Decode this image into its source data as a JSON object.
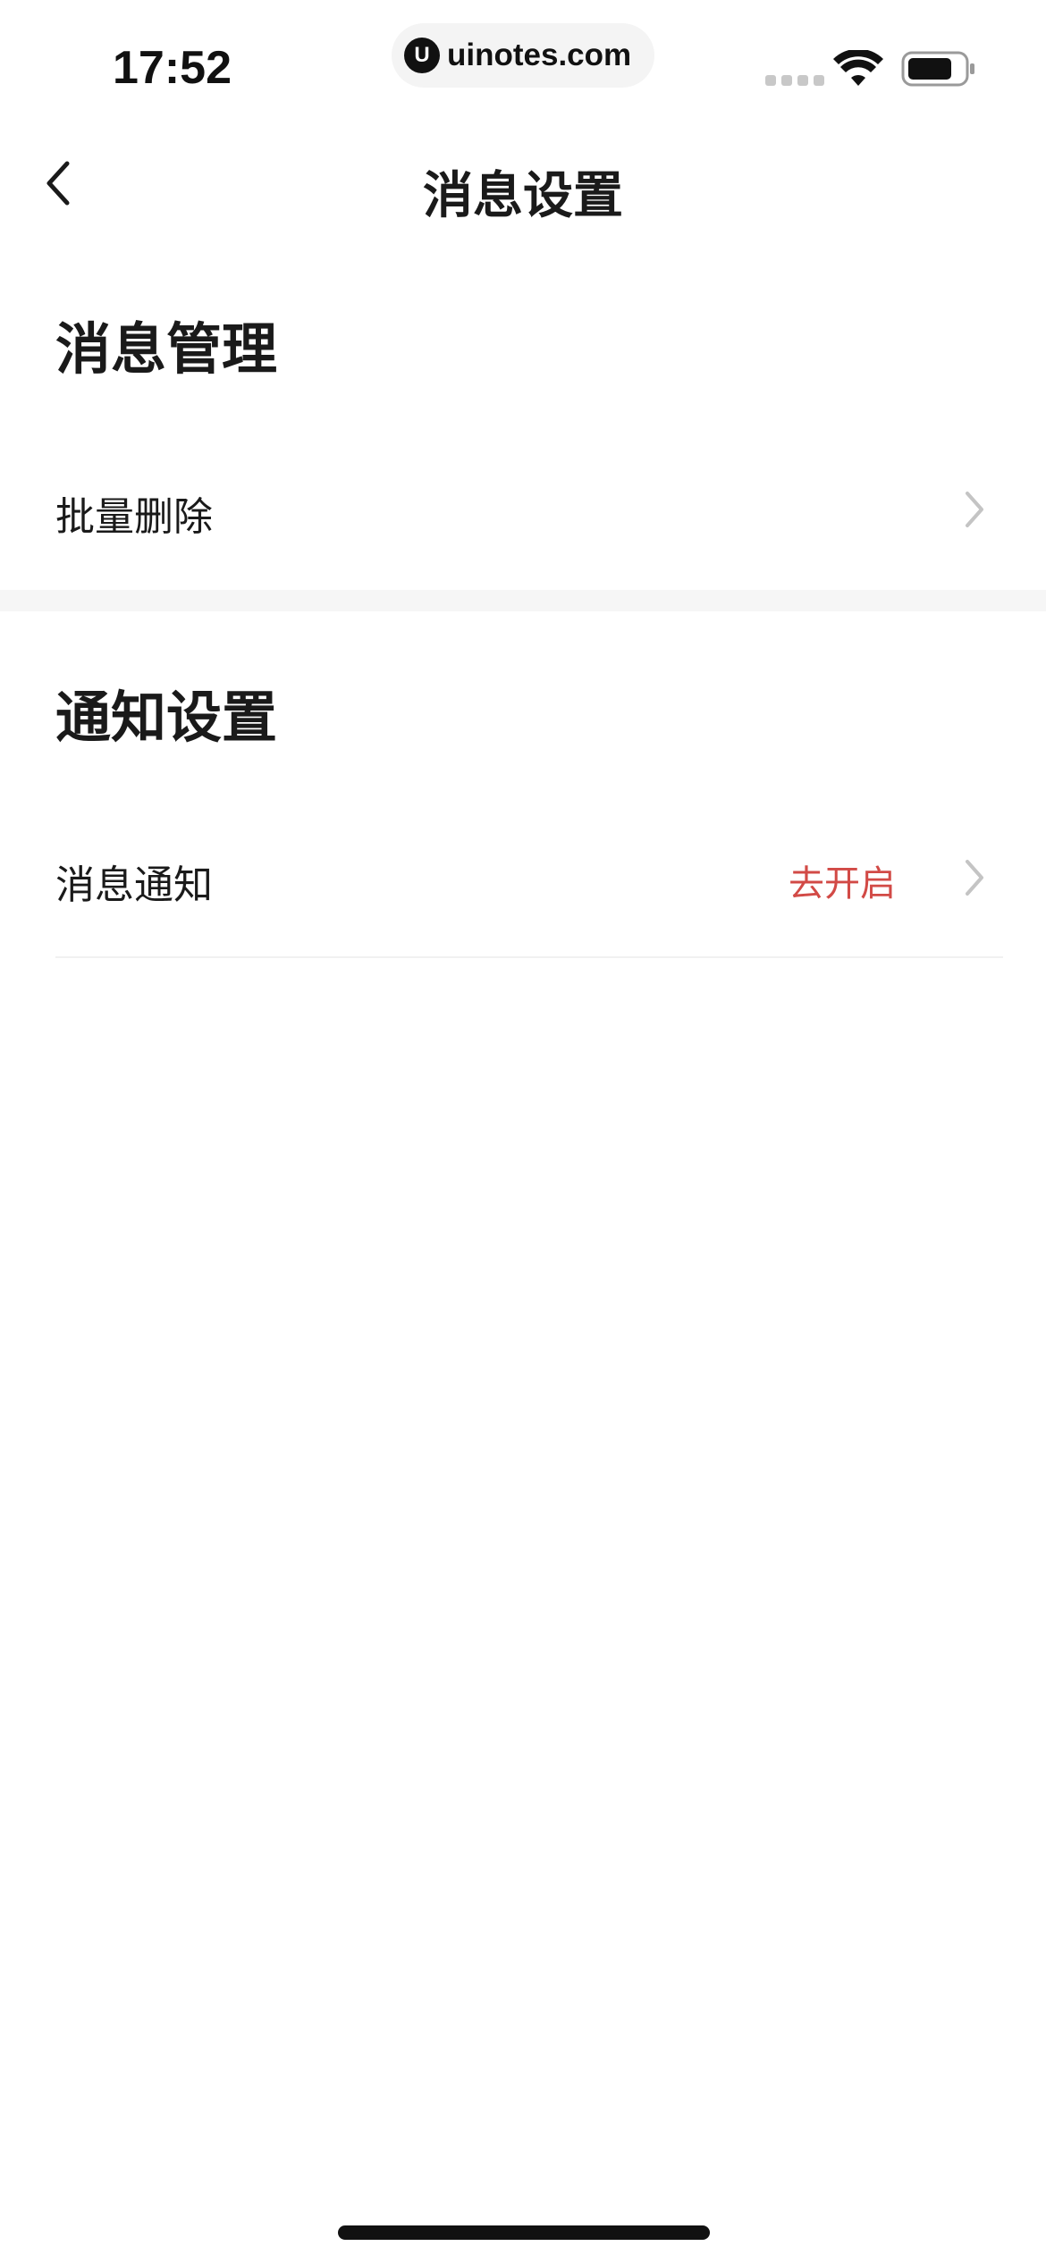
{
  "status_bar": {
    "time": "17:52",
    "url": "uinotes.com",
    "url_logo_letter": "U",
    "icons": [
      "signal-dots-icon",
      "wifi-icon",
      "battery-icon"
    ]
  },
  "nav": {
    "title": "消息设置",
    "back_icon": "chevron-left-icon"
  },
  "sections": [
    {
      "title": "消息管理",
      "rows": [
        {
          "label": "批量删除",
          "value": ""
        }
      ]
    },
    {
      "title": "通知设置",
      "rows": [
        {
          "label": "消息通知",
          "value": "去开启"
        }
      ]
    }
  ],
  "colors": {
    "accent_red": "#d24a46",
    "text": "#1a1a1a",
    "chevron": "#c4c4c4",
    "divider": "#f6f6f6"
  }
}
